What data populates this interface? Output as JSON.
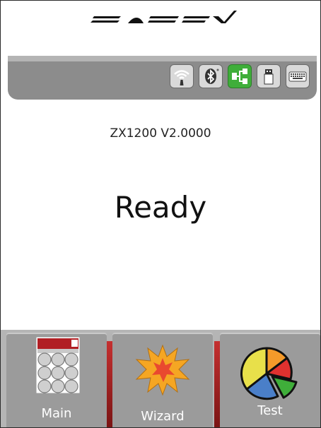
{
  "device": {
    "model": "ZX1200 V2.0000",
    "status": "Ready"
  },
  "status_icons": [
    {
      "name": "wifi-icon",
      "active": false
    },
    {
      "name": "bluetooth-icon",
      "active": false
    },
    {
      "name": "ethernet-icon",
      "active": true
    },
    {
      "name": "usb-icon",
      "active": false
    },
    {
      "name": "keyboard-icon",
      "active": false
    }
  ],
  "nav": {
    "main_label": "Main",
    "wizard_label": "Wizard",
    "test_label": "Test"
  },
  "colors": {
    "active_icon": "#3fae3a",
    "separator_red": "#c53030",
    "pie": [
      "#f49a2a",
      "#e0312f",
      "#3fae3a",
      "#4a7fc9",
      "#e8e04a"
    ]
  }
}
